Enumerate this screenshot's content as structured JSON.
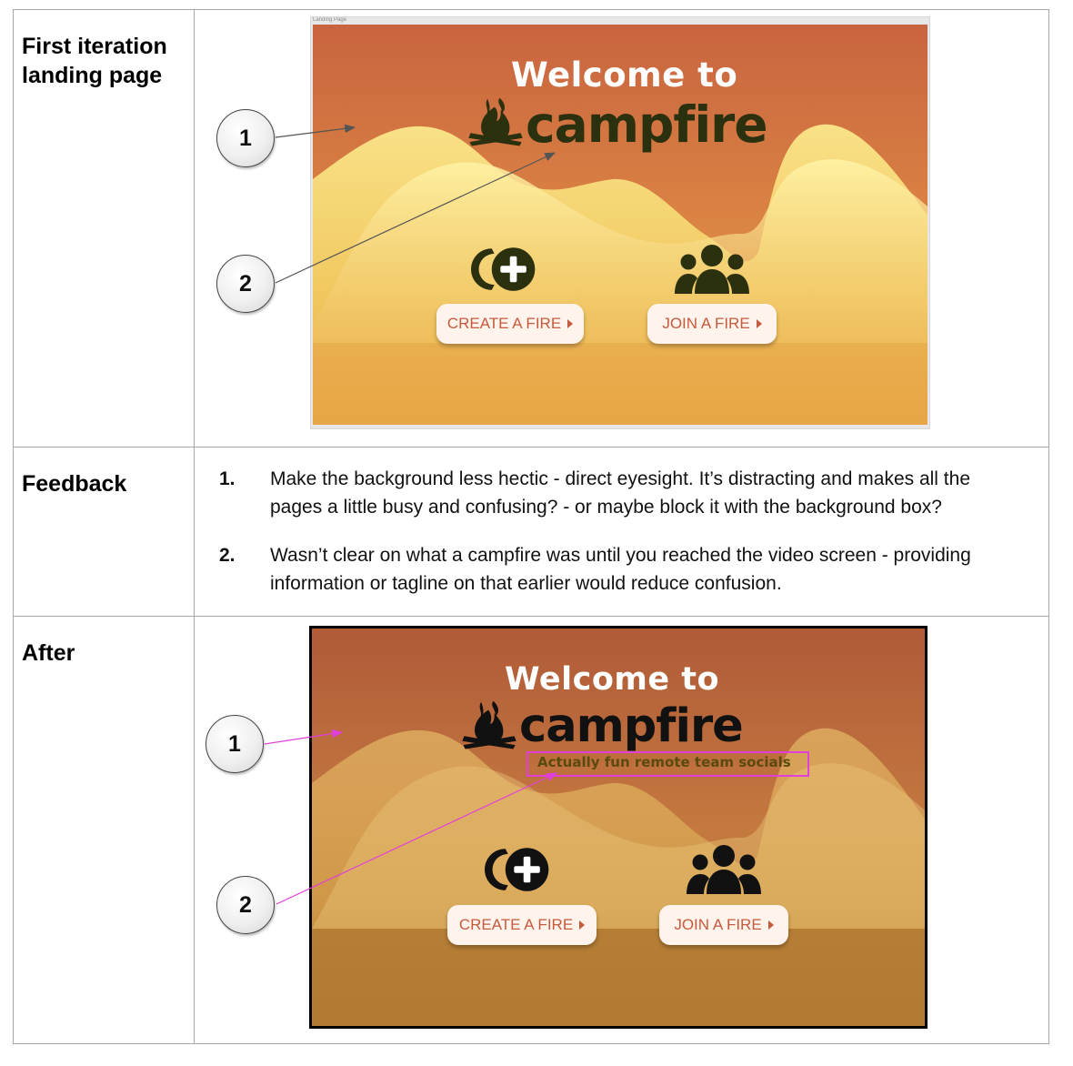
{
  "rows": [
    {
      "label": "First iteration landing page",
      "screenshot": {
        "frame_label": "Landing Page",
        "welcome": "Welcome to",
        "brand": "campfire",
        "buttons": [
          {
            "label": "CREATE A FIRE"
          },
          {
            "label": "JOIN A FIRE"
          }
        ],
        "icons": [
          "campfire-logo-icon",
          "create-fire-plus-icon",
          "group-people-icon"
        ],
        "colors": {
          "sky_top": "#c8643f",
          "sky_mid": "#d98143",
          "wave": "#f3d670",
          "ground": "#e6a445",
          "brand_text": "#2b300f",
          "button_text": "#c55a3c"
        }
      },
      "callouts": [
        "1",
        "2"
      ]
    },
    {
      "label": "Feedback",
      "items": [
        {
          "number": "1.",
          "lines": [
            "Make the background less hectic - direct eyesight. It’s distracting and makes all the",
            "pages a little busy and confusing? - or maybe block it with the background box?"
          ]
        },
        {
          "number": "2.",
          "lines": [
            "Wasn’t clear on what a campfire was until you reached the video screen - providing",
            "information or tagline on that earlier would reduce confusion."
          ]
        }
      ]
    },
    {
      "label": "After",
      "screenshot": {
        "welcome": "Welcome to",
        "brand": "campfire",
        "tagline": "Actually fun remote team socials",
        "buttons": [
          {
            "label": "CREATE A FIRE"
          },
          {
            "label": "JOIN A FIRE"
          }
        ],
        "icons": [
          "campfire-logo-icon",
          "create-fire-plus-icon",
          "group-people-icon"
        ],
        "colors": {
          "sky_top": "#b05a38",
          "wave": "#d9a85a",
          "ground": "#a86c26",
          "brand_text": "#111111",
          "button_text": "#c55a3c",
          "highlight": "#e040d8"
        }
      },
      "callouts": [
        "1",
        "2"
      ]
    }
  ]
}
